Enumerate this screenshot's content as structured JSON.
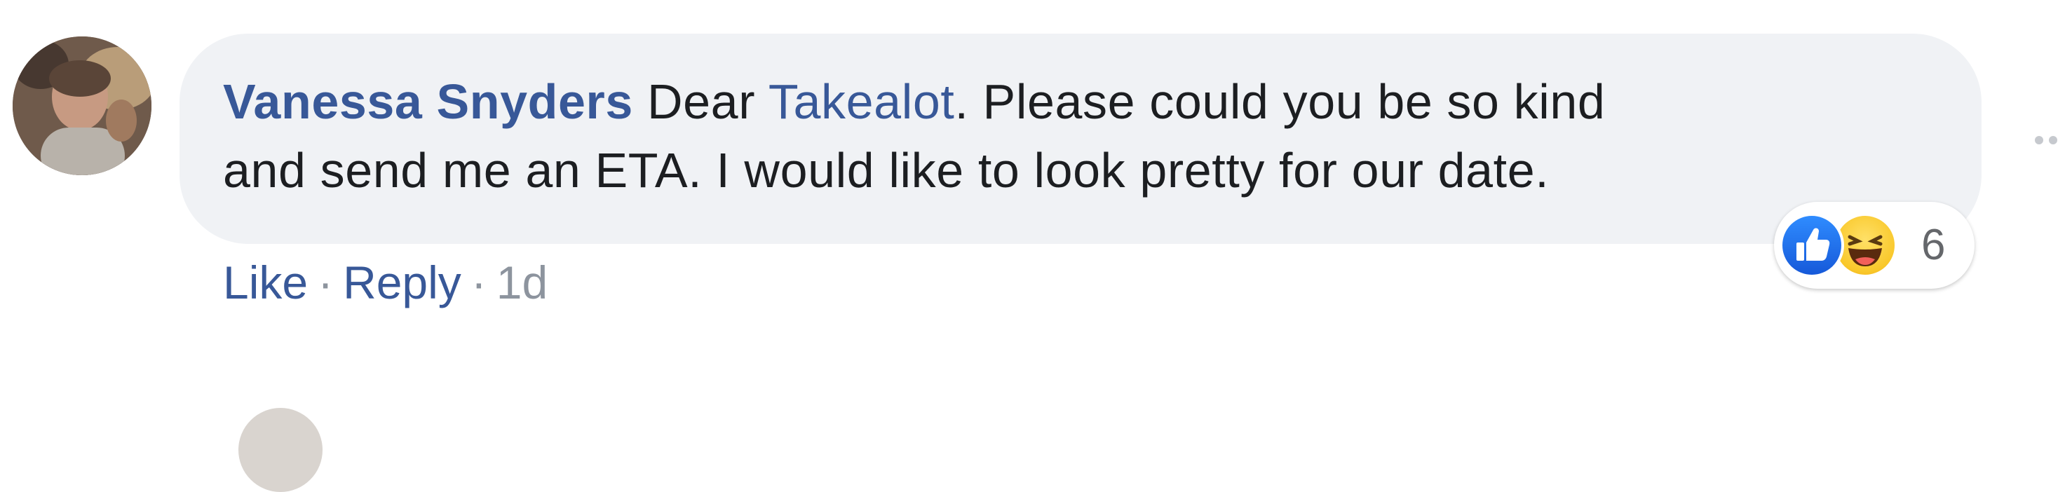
{
  "comment": {
    "author": "Vanessa Snyders",
    "text_before_mention": " Dear ",
    "mention": "Takealot",
    "text_after_mention": ". Please could you be so kind\nand send me an ETA. I would like to look pretty for our date.",
    "reactions": {
      "icons": [
        "like-icon",
        "haha-icon"
      ],
      "count": "6"
    },
    "actions": {
      "like_label": "Like",
      "separator": "·",
      "reply_label": "Reply",
      "timestamp": "1d"
    }
  },
  "colors": {
    "link": "#385898",
    "bubble_bg": "#f0f2f5",
    "text": "#1c1e21",
    "meta": "#8d949e",
    "like_blue": "#1877f2",
    "haha_yellow": "#f9c82b"
  }
}
